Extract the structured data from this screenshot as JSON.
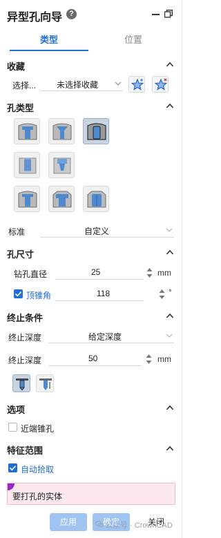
{
  "header": {
    "title": "异型孔向导",
    "help_symbol": "?"
  },
  "tabs": [
    {
      "label": "类型",
      "active": true
    },
    {
      "label": "位置",
      "active": false
    }
  ],
  "favorites": {
    "section_title": "收藏",
    "label": "选择...",
    "value": "未选择收藏"
  },
  "hole_type": {
    "section_title": "孔类型",
    "standard_label": "标准",
    "standard_value": "自定义",
    "selected_index": 2
  },
  "hole_size": {
    "section_title": "孔尺寸",
    "drill_label": "钻孔直径",
    "drill_value": "25",
    "drill_unit": "mm",
    "cone_checked": true,
    "cone_label": "顶锥角",
    "cone_value": "118",
    "cone_unit": "°"
  },
  "end_condition": {
    "section_title": "终止条件",
    "depth_type_label": "终止深度",
    "depth_type_value": "给定深度",
    "depth_label": "终止深度",
    "depth_value": "50",
    "depth_unit": "mm"
  },
  "options": {
    "section_title": "选项",
    "near_cone_label": "近端锥孔",
    "near_cone_checked": false
  },
  "feature_scope": {
    "section_title": "特征范围",
    "auto_pick_label": "自动拾取",
    "auto_pick_checked": true,
    "target_prompt": "要打孔的实体"
  },
  "footer": {
    "apply": "应用",
    "ok": "确定",
    "close": "关闭"
  },
  "watermark": "公众号 · CrownCAD",
  "colors": {
    "accent": "#1f6fd6",
    "primary_button": "#9fc4f2",
    "selection_box": "#fde9ee",
    "selection_dot": "#9b27c4"
  }
}
